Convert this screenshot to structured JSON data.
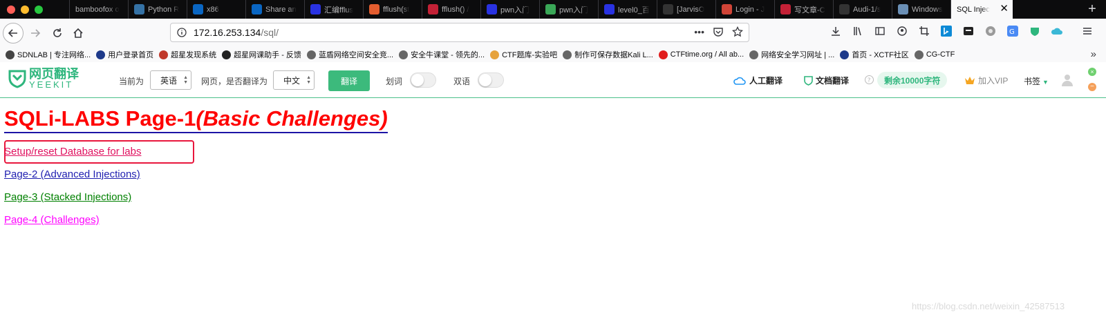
{
  "browser": {
    "tabs": [
      {
        "label": "bamboofox o",
        "icon": "none",
        "icon_color": "#0c0c0d"
      },
      {
        "label": "Python R",
        "icon": "python-icon",
        "icon_color": "#3572a5"
      },
      {
        "label": "x86",
        "icon": "linkedin-icon",
        "icon_color": "#0a66c2"
      },
      {
        "label": "Share an",
        "icon": "linkedin-icon",
        "icon_color": "#0a66c2"
      },
      {
        "label": "汇编fflus",
        "icon": "baidu-icon",
        "icon_color": "#2932e1"
      },
      {
        "label": "fflush(st",
        "icon": "colorful-icon",
        "icon_color": "#e35d2f"
      },
      {
        "label": "fflush() /",
        "icon": "csdn-icon",
        "icon_color": "#c32136"
      },
      {
        "label": "pwn入门",
        "icon": "baidu-icon",
        "icon_color": "#2932e1"
      },
      {
        "label": "pwn入门",
        "icon": "green-icon",
        "icon_color": "#3aa757"
      },
      {
        "label": "level0_百",
        "icon": "baidu-icon",
        "icon_color": "#2932e1"
      },
      {
        "label": "[JarvisO",
        "icon": "github-icon",
        "icon_color": "#333333"
      },
      {
        "label": "Login - J",
        "icon": "jira-icon",
        "icon_color": "#d04437"
      },
      {
        "label": "写文章-C",
        "icon": "csdn-icon",
        "icon_color": "#c32136"
      },
      {
        "label": "Audi-1/s",
        "icon": "github-icon",
        "icon_color": "#333333"
      },
      {
        "label": "Windows",
        "icon": "windows-icon",
        "icon_color": "#6a8fb5"
      },
      {
        "label": "SQL Injec",
        "icon": "none",
        "icon_color": "#0c0c0d",
        "active": true
      }
    ],
    "url": {
      "host": "172.16.253.134",
      "path": "/sql/"
    },
    "bookmarks": [
      {
        "label": "SDNLAB | 专注网络...",
        "color": "#444444"
      },
      {
        "label": "用户登录首页",
        "color": "#1e3a8a"
      },
      {
        "label": "超星发现系统",
        "color": "#c0392b"
      },
      {
        "label": "超星网课助手 - 反馈",
        "color": "#222222"
      },
      {
        "label": "蓝盾网络空间安全竞...",
        "color": "#666666"
      },
      {
        "label": "安全牛课堂 - 领先的...",
        "color": "#666666"
      },
      {
        "label": "CTF题库-实验吧",
        "color": "#e6a23c"
      },
      {
        "label": "制作可保存数据Kali L...",
        "color": "#666666"
      },
      {
        "label": "CTFtime.org / All ab...",
        "color": "#e11d1d"
      },
      {
        "label": "网络安全学习网址 | ...",
        "color": "#666666"
      },
      {
        "label": "首页 - XCTF社区",
        "color": "#1e3a8a"
      },
      {
        "label": "CG-CTF",
        "color": "#666666"
      }
    ]
  },
  "translator": {
    "logo_cn": "网页翻译",
    "logo_en": "YEEKIT",
    "current_label": "当前为",
    "source_lang": "英语",
    "question_label": "网页，是否翻译为",
    "target_lang": "中文",
    "translate_button": "翻译",
    "word_label": "划词",
    "bilingual_label": "双语",
    "human_translate": "人工翻译",
    "doc_translate": "文档翻译",
    "quota": "剩余10000字符",
    "vip": "加入VIP",
    "bookmark": "书签"
  },
  "page": {
    "title_main": "SQLi-LABS Page-1",
    "title_sub": "(Basic Challenges)",
    "links": [
      {
        "label": "Setup/reset Database for labs",
        "color": "#e0115f"
      },
      {
        "label": "Page-2 (Advanced Injections)",
        "color": "#1f1fb0"
      },
      {
        "label": "Page-3 (Stacked Injections)",
        "color": "#008000"
      },
      {
        "label": "Page-4 (Challenges)",
        "color": "#ff00ff"
      }
    ],
    "watermark": "https://blog.csdn.net/weixin_42587513"
  }
}
